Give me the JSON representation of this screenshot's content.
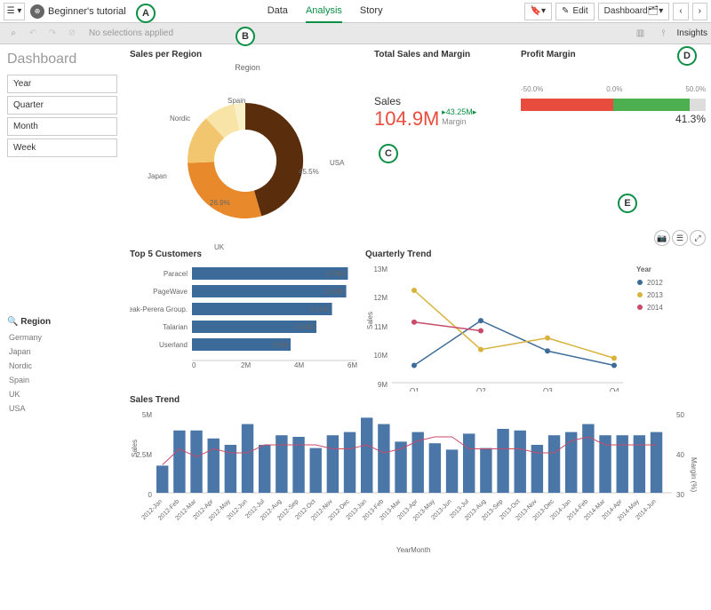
{
  "toolbar": {
    "app_title": "Beginner's tutorial",
    "tabs": {
      "data": "Data",
      "analysis": "Analysis",
      "story": "Story"
    },
    "edit": "Edit",
    "sheet_dropdown": "Dashboard"
  },
  "selbar": {
    "no_selections": "No selections applied",
    "insights": "Insights"
  },
  "sidebar": {
    "title": "Dashboard",
    "filters": [
      "Year",
      "Quarter",
      "Month",
      "Week"
    ],
    "region_label": "Region",
    "regions": [
      "Germany",
      "Japan",
      "Nordic",
      "Spain",
      "UK",
      "USA"
    ]
  },
  "callouts": {
    "a": "A",
    "b": "B",
    "c": "C",
    "d": "D",
    "e": "E"
  },
  "donut": {
    "title": "Sales per Region",
    "subtitle": "Region"
  },
  "kpi": {
    "title": "Total Sales and Margin",
    "label": "Sales",
    "value": "104.9M",
    "margin_value": "43.25M",
    "margin_label": "Margin"
  },
  "gauge": {
    "title": "Profit Margin",
    "ticks": [
      "-50.0%",
      "0.0%",
      "50.0%"
    ],
    "value": "41.3%"
  },
  "bars": {
    "title": "Top 5 Customers"
  },
  "qtrend": {
    "title": "Quarterly Trend",
    "legend_title": "Year",
    "ylabel": "Sales"
  },
  "salestrend": {
    "title": "Sales Trend",
    "xlabel": "YearMonth",
    "ylabel": "Sales",
    "ylabel2": "Margin (%)"
  },
  "chart_data": [
    {
      "type": "pie",
      "title": "Sales per Region",
      "series": [
        {
          "name": "USA",
          "value": 45.5,
          "color": "#5a2d0c"
        },
        {
          "name": "UK",
          "value": 26.9,
          "color": "#e8892b"
        },
        {
          "name": "Japan",
          "value": 13.0,
          "color": "#f2c56f"
        },
        {
          "name": "Nordic",
          "value": 9.0,
          "color": "#f7e4a6"
        },
        {
          "name": "Spain",
          "value": 5.6,
          "color": "#f9f0c8"
        }
      ]
    },
    {
      "type": "bar",
      "title": "Top 5 Customers",
      "orientation": "horizontal",
      "xlim": [
        0,
        6
      ],
      "xticks": [
        "0",
        "2M",
        "4M",
        "6M"
      ],
      "categories": [
        "Paracel",
        "PageWave",
        "Deak-Perera Group.",
        "Talarian",
        "Userland"
      ],
      "values": [
        5.69,
        5.63,
        5.11,
        4.54,
        3.6
      ],
      "value_labels": [
        "5.69M",
        "5.63M",
        "5.11M",
        "4.54M",
        "3.6M"
      ],
      "color": "#3d6b99"
    },
    {
      "type": "line",
      "title": "Quarterly Trend",
      "xlabel": "",
      "ylabel": "Sales",
      "categories": [
        "Q1",
        "Q2",
        "Q3",
        "Q4"
      ],
      "ylim": [
        9,
        13
      ],
      "yunit": "M",
      "series": [
        {
          "name": "2012",
          "color": "#3d6b99",
          "values": [
            9.6,
            11.15,
            10.1,
            9.6
          ]
        },
        {
          "name": "2013",
          "color": "#d9b23c",
          "values": [
            12.2,
            10.15,
            10.55,
            9.85
          ]
        },
        {
          "name": "2014",
          "color": "#c94b6a",
          "values": [
            11.1,
            10.8,
            null,
            null
          ]
        }
      ]
    },
    {
      "type": "bar",
      "title": "Sales Trend",
      "xlabel": "YearMonth",
      "ylabel": "Sales",
      "ylabel2": "Margin (%)",
      "ylim": [
        0,
        5
      ],
      "yunit": "M",
      "ylim2": [
        30,
        50
      ],
      "categories": [
        "2012-Jan",
        "2012-Feb",
        "2012-Mar",
        "2012-Apr",
        "2012-May",
        "2012-Jun",
        "2012-Jul",
        "2012-Aug",
        "2012-Sep",
        "2012-Oct",
        "2012-Nov",
        "2012-Dec",
        "2013-Jan",
        "2013-Feb",
        "2013-Mar",
        "2013-Apr",
        "2013-May",
        "2013-Jun",
        "2013-Jul",
        "2013-Aug",
        "2013-Sep",
        "2013-Oct",
        "2013-Nov",
        "2013-Dec",
        "2014-Jan",
        "2014-Feb",
        "2014-Mar",
        "2014-Apr",
        "2014-May",
        "2014-Jun"
      ],
      "values": [
        1.7,
        3.9,
        3.9,
        3.4,
        3.0,
        4.3,
        3.0,
        3.6,
        3.5,
        2.8,
        3.6,
        3.8,
        4.7,
        4.3,
        3.2,
        3.8,
        3.1,
        2.7,
        3.7,
        2.8,
        4.0,
        3.9,
        3.0,
        3.6,
        3.8,
        4.3,
        3.6,
        3.6,
        3.6,
        3.8
      ],
      "color": "#4a77a8",
      "overlay_line": {
        "name": "Margin (%)",
        "color": "#c94b6a",
        "values": [
          37,
          41,
          39,
          41,
          40,
          40,
          42,
          42,
          42,
          42,
          41,
          41,
          42,
          40,
          41,
          43,
          44,
          44,
          41,
          41,
          41,
          41,
          40,
          40,
          43,
          44,
          42,
          42,
          42,
          42
        ]
      }
    }
  ]
}
